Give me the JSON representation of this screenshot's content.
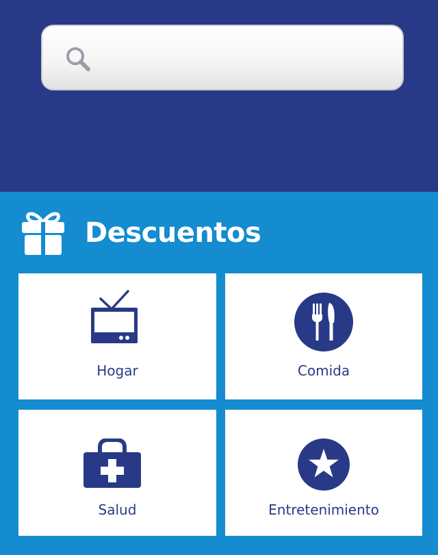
{
  "search": {
    "placeholder": "",
    "icon": "search-icon"
  },
  "section": {
    "title": "Descuentos",
    "icon": "gift-icon"
  },
  "categories": [
    {
      "label": "Hogar",
      "icon": "tv-icon"
    },
    {
      "label": "Comida",
      "icon": "fork-spoon-icon"
    },
    {
      "label": "Salud",
      "icon": "medical-kit-icon"
    },
    {
      "label": "Entretenimiento",
      "icon": "star-icon"
    }
  ],
  "colors": {
    "header_bg": "#283a87",
    "section_bg": "#148ccf",
    "tile_bg": "#ffffff",
    "icon_color": "#283a87"
  }
}
